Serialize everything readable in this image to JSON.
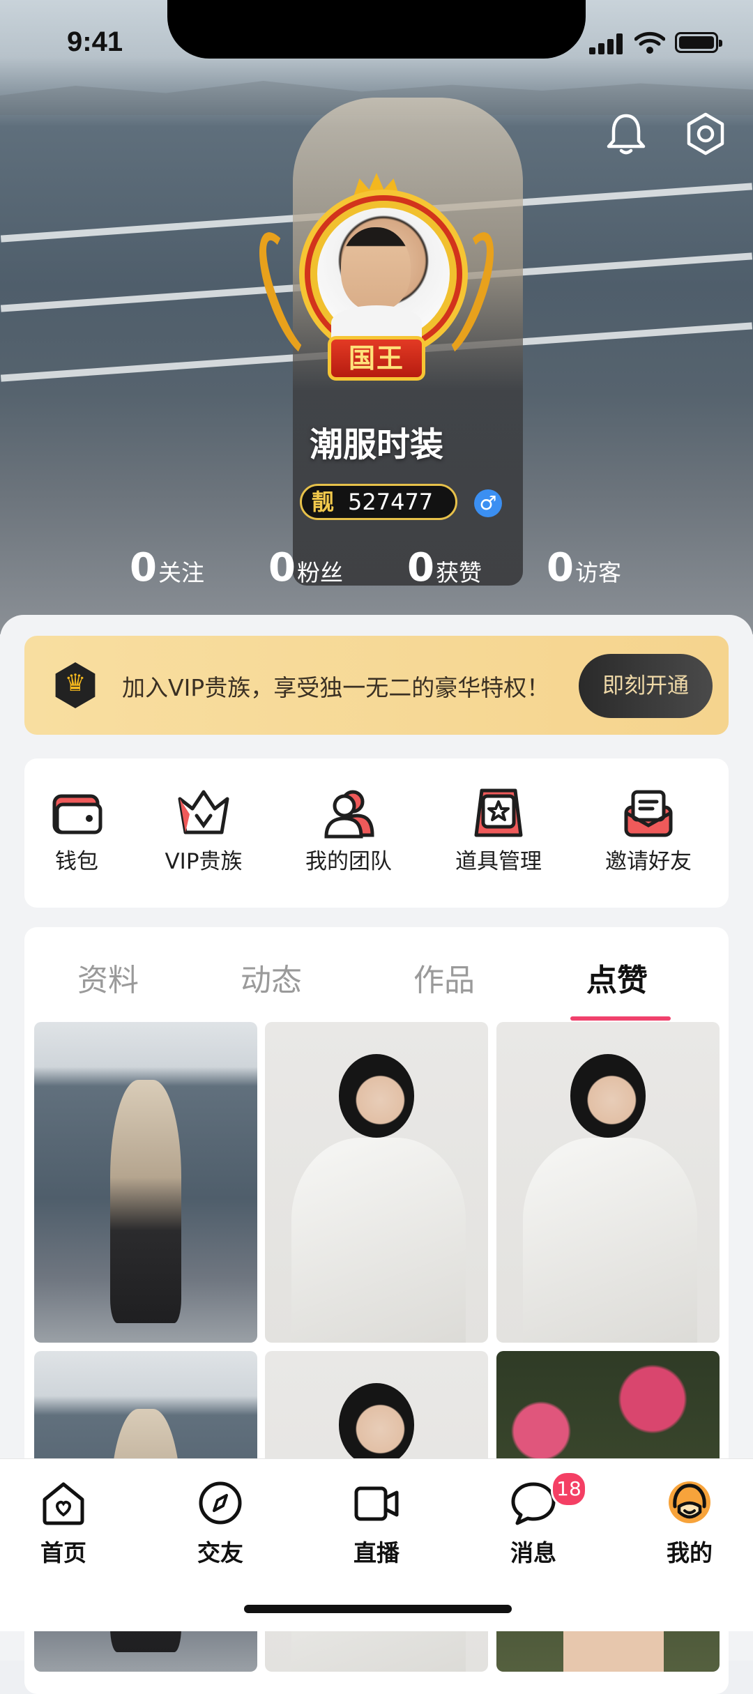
{
  "status_bar": {
    "time": "9:41"
  },
  "profile": {
    "crown_badge": "国王",
    "username": "潮服时装",
    "id_prefix": "靓",
    "id_number": "527477",
    "gender_symbol": "♂"
  },
  "stats": [
    {
      "value": "0",
      "label": "关注"
    },
    {
      "value": "0",
      "label": "粉丝"
    },
    {
      "value": "0",
      "label": "获赞"
    },
    {
      "value": "0",
      "label": "访客"
    }
  ],
  "vip_banner": {
    "text": "加入VIP贵族，享受独一无二的豪华特权！",
    "button": "即刻开通"
  },
  "menu": [
    {
      "label": "钱包",
      "icon": "wallet-icon"
    },
    {
      "label": "VIP贵族",
      "icon": "crown-icon"
    },
    {
      "label": "我的团队",
      "icon": "team-icon"
    },
    {
      "label": "道具管理",
      "icon": "props-icon"
    },
    {
      "label": "邀请好友",
      "icon": "invite-icon"
    }
  ],
  "tabs": [
    {
      "label": "资料",
      "active": false
    },
    {
      "label": "动态",
      "active": false
    },
    {
      "label": "作品",
      "active": false
    },
    {
      "label": "点赞",
      "active": true
    }
  ],
  "tab_bar": [
    {
      "label": "首页",
      "icon": "home-icon"
    },
    {
      "label": "交友",
      "icon": "compass-icon"
    },
    {
      "label": "直播",
      "icon": "video-icon"
    },
    {
      "label": "消息",
      "icon": "chat-icon",
      "badge": "18"
    },
    {
      "label": "我的",
      "icon": "profile-face-icon",
      "active": true
    }
  ],
  "colors": {
    "accent": "#f0416c",
    "vip_gold": "#f5d48e",
    "active_tab_icon": "#f7a33b"
  }
}
